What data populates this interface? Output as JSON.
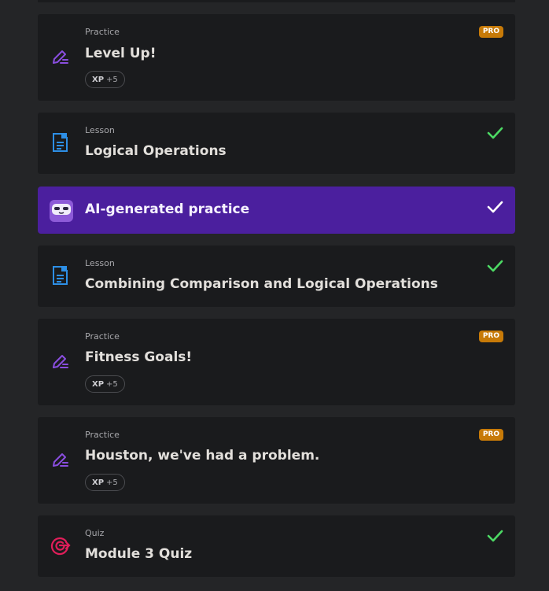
{
  "cards": [
    {
      "type": "Practice",
      "title": "Level Up!",
      "badge": "PRO",
      "xp_label": "XP",
      "xp_value": "+5"
    },
    {
      "type": "Lesson",
      "title": "Logical Operations"
    },
    {
      "title": "AI-generated practice"
    },
    {
      "type": "Lesson",
      "title": "Combining Comparison and Logical Operations"
    },
    {
      "type": "Practice",
      "title": "Fitness Goals!",
      "badge": "PRO",
      "xp_label": "XP",
      "xp_value": "+5"
    },
    {
      "type": "Practice",
      "title": "Houston, we've had a problem.",
      "badge": "PRO",
      "xp_label": "XP",
      "xp_value": "+5"
    },
    {
      "type": "Quiz",
      "title": "Module 3 Quiz"
    }
  ],
  "colors": {
    "practice_icon": "#8a4ee0",
    "lesson_icon": "#2d8fe6",
    "quiz_icon": "#e01e5a",
    "check_green": "#4cd964",
    "pro_badge": "#c77a08",
    "ai_card": "#4b1f9e"
  }
}
